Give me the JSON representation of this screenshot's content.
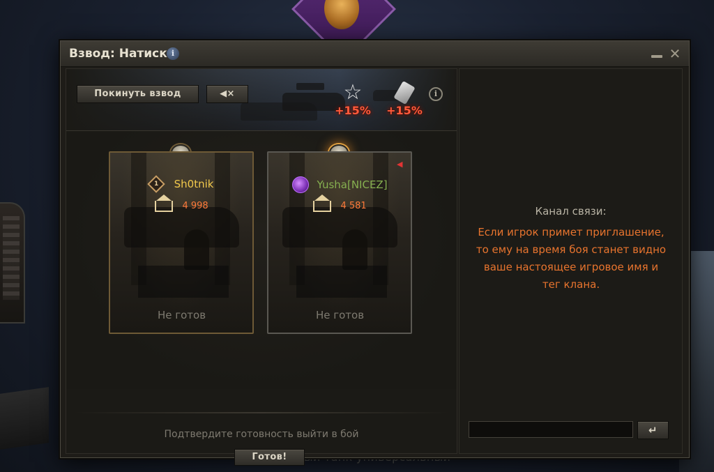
{
  "background": {
    "bottom_text": "Тяжелый танк универсальный"
  },
  "window": {
    "title": "Взвод: Натиск",
    "title_info_glyph": "i",
    "minimize_icon": "minimize-icon",
    "close_icon": "close-icon"
  },
  "toolbar": {
    "leave_label": "Покинуть взвод",
    "mute_label": "◀×",
    "info_glyph": "i"
  },
  "bonuses": [
    {
      "icon": "star-icon",
      "value": "+15%"
    },
    {
      "icon": "credits-icon",
      "value": "+15%"
    }
  ],
  "players": [
    {
      "rank": "1",
      "name": "Sh0tnik",
      "name_color": "#f2c94c",
      "rating": "4 998",
      "status": "Не готов"
    },
    {
      "name": "Yusha[NICEZ]",
      "name_color": "#86b050",
      "rating": "4 581",
      "status": "Не готов"
    }
  ],
  "footer": {
    "confirm_text": "Подтвердите готовность выйти в бой",
    "ready_label": "Готов!"
  },
  "chat": {
    "channel_title": "Канал связи:",
    "message": "Если игрок примет приглашение, то ему на время боя станет видно ваше настоящее игровое имя и тег клана.",
    "input_value": "",
    "send_glyph": "↵"
  },
  "colors": {
    "accent_orange": "#e8742e",
    "bonus_red": "#ff5a3c",
    "nick_gold": "#f2c94c",
    "nick_green": "#86b050"
  }
}
